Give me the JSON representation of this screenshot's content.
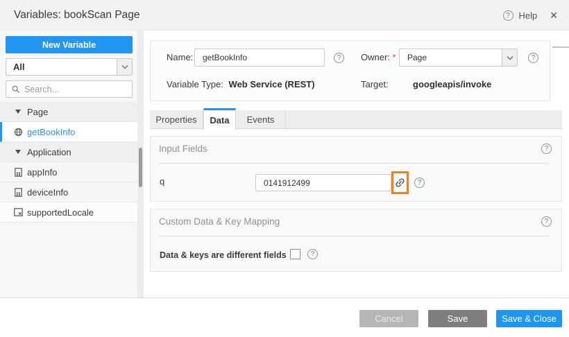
{
  "header": {
    "title": "Variables: bookScan Page",
    "help_label": "Help"
  },
  "icons": {
    "help_glyph": "?",
    "close_glyph": "✕"
  },
  "sidebar": {
    "new_variable_label": "New Variable",
    "filter": {
      "value": "All"
    },
    "search": {
      "placeholder": "Search..."
    },
    "tree": [
      {
        "label": "Page",
        "type": "group",
        "expanded": true
      },
      {
        "label": "getBookInfo",
        "type": "item",
        "icon": "web-service-icon",
        "selected": true
      },
      {
        "label": "Application",
        "type": "group",
        "expanded": true
      },
      {
        "label": "appInfo",
        "type": "item",
        "icon": "device-icon",
        "selected": false
      },
      {
        "label": "deviceInfo",
        "type": "item",
        "icon": "device-icon",
        "selected": false
      },
      {
        "label": "supportedLocale",
        "type": "item",
        "icon": "locale-icon",
        "selected": false
      }
    ]
  },
  "details": {
    "name_label": "Name:",
    "required_marker": "*",
    "name_value": "getBookInfo",
    "owner_label": "Owner:",
    "owner_value": "Page",
    "variable_type_label": "Variable Type:",
    "variable_type_value": "Web Service (REST)",
    "target_label": "Target:",
    "target_value": "googleapis/invoke"
  },
  "tabs": [
    {
      "label": "Properties",
      "active": false
    },
    {
      "label": "Data",
      "active": true
    },
    {
      "label": "Events",
      "active": false
    }
  ],
  "sections": {
    "input_fields": {
      "title": "Input Fields",
      "rows": [
        {
          "label": "q",
          "value": "0141912499",
          "mapped_icon": "chain-link-icon",
          "highlighted": true
        }
      ]
    },
    "custom_mapping": {
      "title": "Custom Data & Key Mapping",
      "checkbox_label": "Data & keys are different fields",
      "checkbox_checked": false
    }
  },
  "footer": {
    "cancel_label": "Cancel",
    "save_label": "Save",
    "save_close_label": "Save & Close"
  },
  "colors": {
    "accent_blue": "#2196f3",
    "annotation_orange": "#ee8223",
    "cancel_gray": "#b5b5b5",
    "save_gray": "#7f7f7f",
    "required_red": "#e5443c"
  }
}
